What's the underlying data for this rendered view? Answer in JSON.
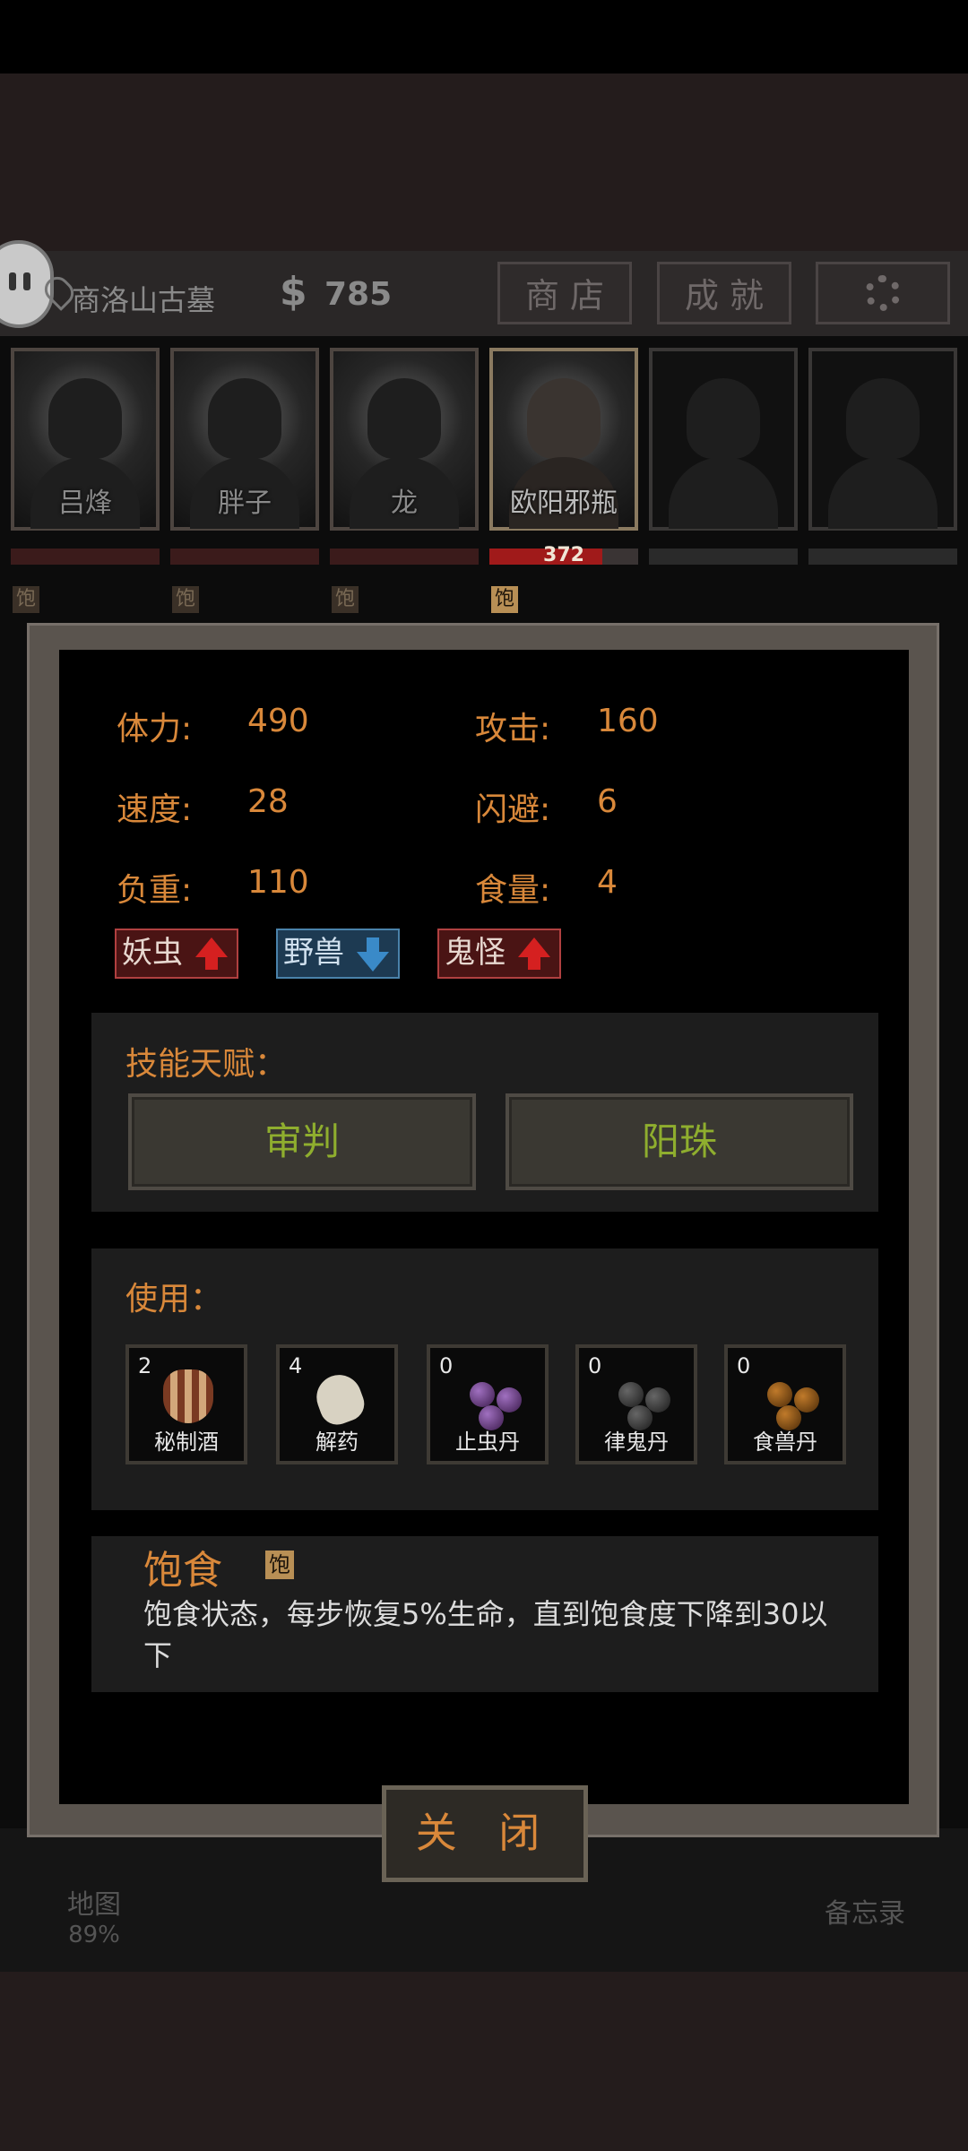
{
  "location": {
    "name": "商洛山古墓"
  },
  "money": {
    "symbol": "$",
    "value": "785"
  },
  "top_buttons": {
    "shop": "商 店",
    "achievements": "成 就"
  },
  "party": [
    {
      "name": "吕烽",
      "hp_text": "",
      "satiety_badge": "饱"
    },
    {
      "name": "胖子",
      "hp_text": "",
      "satiety_badge": "饱"
    },
    {
      "name": "龙",
      "hp_text": "",
      "satiety_badge": "饱"
    },
    {
      "name": "欧阳邪瓶",
      "hp_text": "372",
      "satiety_badge": "饱"
    },
    {
      "name": "",
      "hp_text": ""
    },
    {
      "name": "",
      "hp_text": ""
    }
  ],
  "stats": {
    "stamina_label": "体力:",
    "stamina_value": "490",
    "attack_label": "攻击:",
    "attack_value": "160",
    "speed_label": "速度:",
    "speed_value": "28",
    "dodge_label": "闪避:",
    "dodge_value": "6",
    "load_label": "负重:",
    "load_value": "110",
    "food_label": "食量:",
    "food_value": "4"
  },
  "tags": [
    {
      "label": "妖虫",
      "direction": "up",
      "color": "#d52020"
    },
    {
      "label": "野兽",
      "direction": "down",
      "color": "#3a8ac8"
    },
    {
      "label": "鬼怪",
      "direction": "up",
      "color": "#d52020"
    }
  ],
  "skills": {
    "title": "技能天赋：",
    "items": [
      "审判",
      "阳珠"
    ]
  },
  "usage": {
    "title": "使用：",
    "items": [
      {
        "count": "2",
        "label": "秘制酒",
        "icon": "wine-jar-icon"
      },
      {
        "count": "4",
        "label": "解药",
        "icon": "antidote-icon"
      },
      {
        "count": "0",
        "label": "止虫丹",
        "icon": "purple-pills-icon"
      },
      {
        "count": "0",
        "label": "律鬼丹",
        "icon": "dark-pills-icon"
      },
      {
        "count": "0",
        "label": "食兽丹",
        "icon": "brown-pills-icon"
      }
    ]
  },
  "status": {
    "title": "饱食",
    "badge": "饱",
    "description": "饱食状态，每步恢复5%生命，直到饱食度下降到30以下"
  },
  "close_label": "关 闭",
  "bottom_nav": {
    "map_label": "地图",
    "map_percent": "89%",
    "memo_label": "备忘录"
  },
  "colors": {
    "accent": "#d9883a",
    "skill_text": "#8fae2e",
    "hp_red": "#a01a1a"
  }
}
